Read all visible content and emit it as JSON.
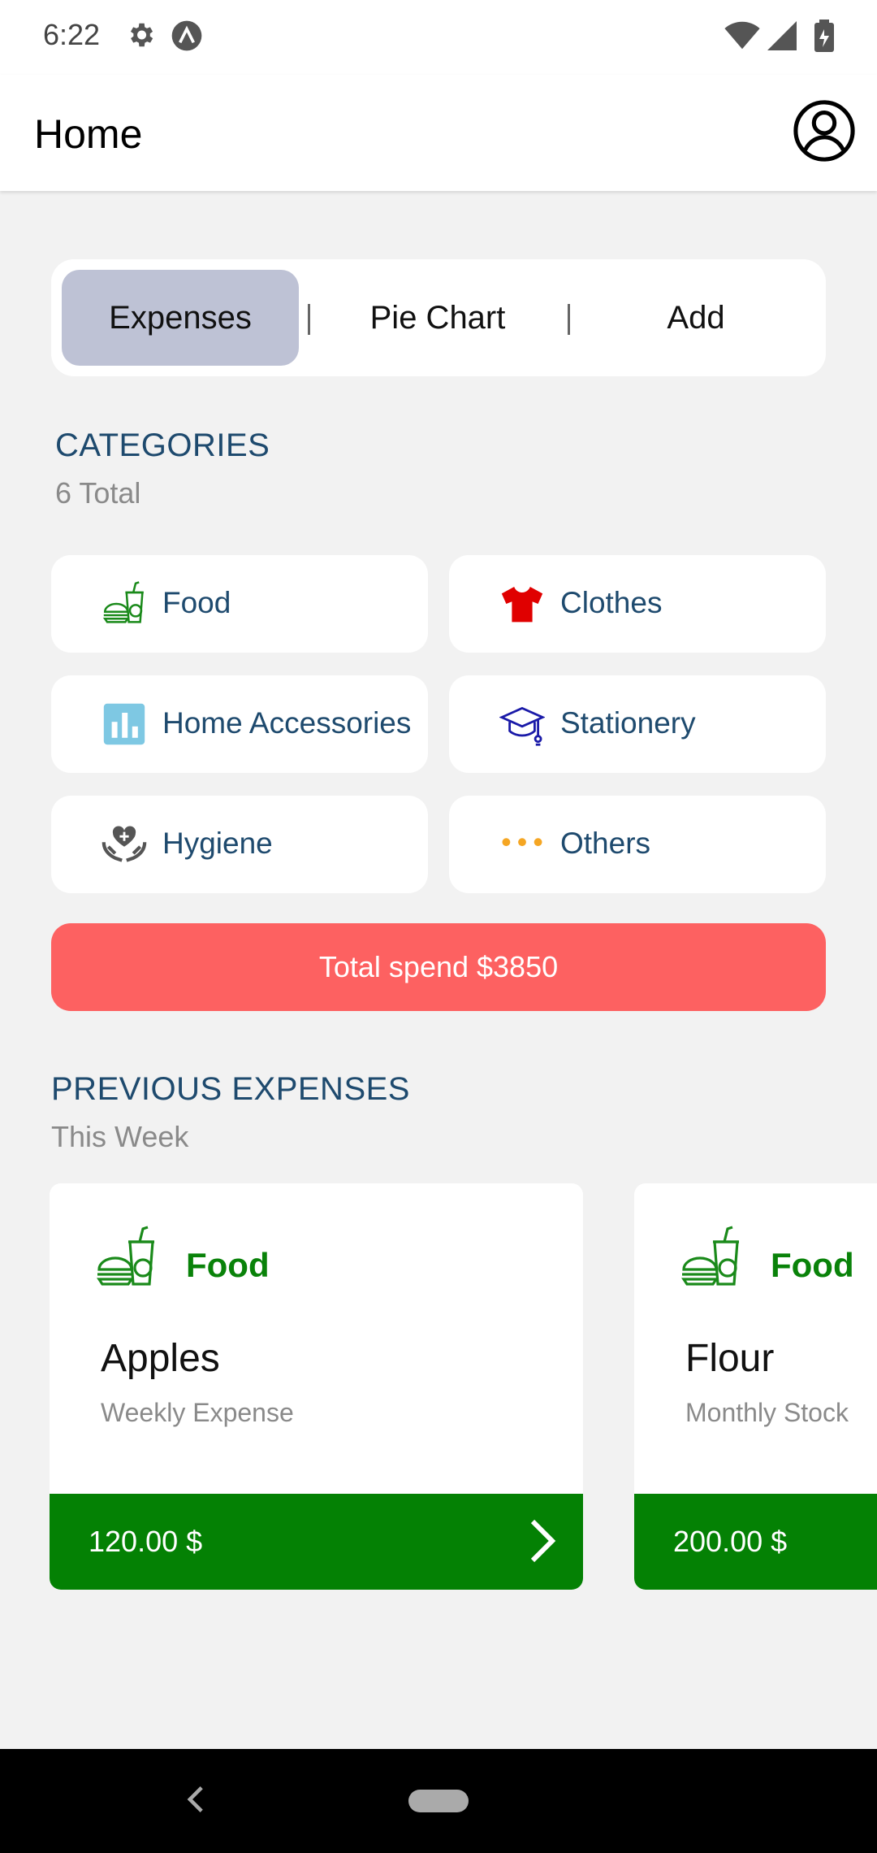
{
  "status": {
    "time": "6:22",
    "icons": [
      "settings-icon",
      "a-badge-icon",
      "wifi-icon",
      "signal-icon",
      "battery-icon"
    ]
  },
  "appbar": {
    "title": "Home",
    "profile_icon": "account-circle-icon"
  },
  "tabs": [
    {
      "label": "Expenses",
      "active": true
    },
    {
      "label": "Pie Chart",
      "active": false
    },
    {
      "label": "Add",
      "active": false
    }
  ],
  "categories": {
    "title": "CATEGORIES",
    "subtitle": "6 Total",
    "items": [
      {
        "label": "Food",
        "icon": "food-icon",
        "color": "#1a8a1a"
      },
      {
        "label": "Clothes",
        "icon": "tshirt-icon",
        "color": "#e00000"
      },
      {
        "label": "Home Accessories",
        "icon": "bar-chart-icon",
        "color": "#7ec8e3"
      },
      {
        "label": "Stationery",
        "icon": "graduation-cap-icon",
        "color": "#1a1aa8"
      },
      {
        "label": "Hygiene",
        "icon": "hands-heart-icon",
        "color": "#555555"
      },
      {
        "label": "Others",
        "icon": "more-dots-icon",
        "color": "#f5a623"
      }
    ]
  },
  "total": {
    "label": "Total spend $3850"
  },
  "previous": {
    "title": "PREVIOUS EXPENSES",
    "subtitle": "This Week",
    "cards": [
      {
        "category": "Food",
        "title": "Apples",
        "subtitle": "Weekly Expense",
        "amount": "120.00 $"
      },
      {
        "category": "Food",
        "title": "Flour",
        "subtitle": "Monthly Stock",
        "amount": "200.00 $"
      }
    ]
  },
  "colors": {
    "accent_green": "#048104",
    "total_red": "#fd6161",
    "tab_active": "#bec2d5",
    "heading": "#1e4a6e"
  }
}
